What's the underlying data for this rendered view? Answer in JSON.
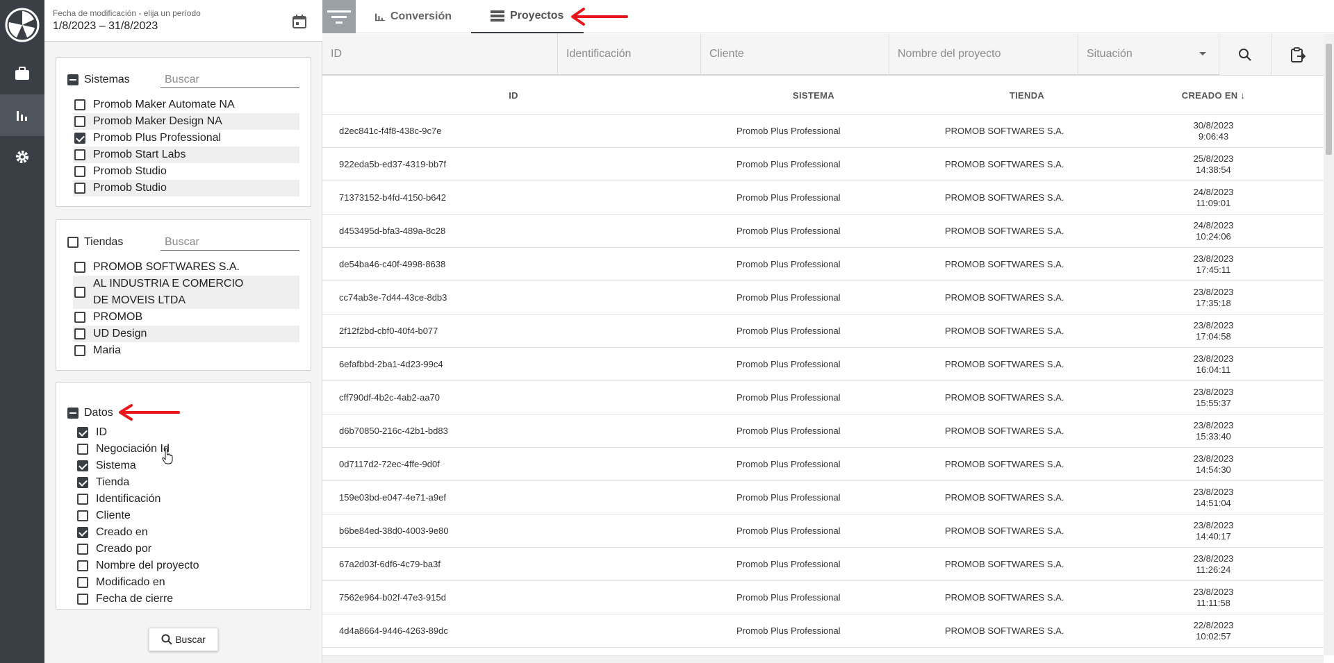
{
  "date_filter": {
    "label": "Fecha de modificación - elija un período",
    "value": "1/8/2023 – 31/8/2023"
  },
  "sistemas": {
    "label": "Sistemas",
    "placeholder": "Buscar",
    "items": [
      {
        "label": "Promob Maker Automate NA",
        "checked": false
      },
      {
        "label": "Promob Maker Design NA",
        "checked": false
      },
      {
        "label": "Promob Plus Professional",
        "checked": true
      },
      {
        "label": "Promob Start Labs",
        "checked": false
      },
      {
        "label": "Promob Studio",
        "checked": false
      },
      {
        "label": "Promob Studio",
        "checked": false
      }
    ]
  },
  "tiendas": {
    "label": "Tiendas",
    "placeholder": "Buscar",
    "items": [
      {
        "label": "PROMOB SOFTWARES S.A.",
        "checked": false
      },
      {
        "label": "AL  INDUSTRIA E COMERCIO DE MOVEIS LTDA",
        "label_line1": "AL  INDUSTRIA E COMERCIO",
        "label_line2": "DE MOVEIS LTDA",
        "checked": false
      },
      {
        "label": "PROMOB",
        "checked": false
      },
      {
        "label": "UD Design",
        "checked": false
      },
      {
        "label": "Maria",
        "checked": false
      }
    ]
  },
  "datos": {
    "label": "Datos",
    "items": [
      {
        "label": "ID",
        "checked": true
      },
      {
        "label": "Negociación Id",
        "checked": false
      },
      {
        "label": "Sistema",
        "checked": true
      },
      {
        "label": "Tienda",
        "checked": true
      },
      {
        "label": "Identificación",
        "checked": false
      },
      {
        "label": "Cliente",
        "checked": false
      },
      {
        "label": "Creado en",
        "checked": true
      },
      {
        "label": "Creado por",
        "checked": false
      },
      {
        "label": "Nombre del proyecto",
        "checked": false
      },
      {
        "label": "Modificado en",
        "checked": false
      },
      {
        "label": "Fecha de cierre",
        "checked": false
      }
    ]
  },
  "search_button": "Buscar",
  "tabs": [
    {
      "label": "Conversión",
      "icon": "bar-chart-icon",
      "active": false
    },
    {
      "label": "Proyectos",
      "icon": "list-icon",
      "active": true
    }
  ],
  "filters": {
    "id_placeholder": "ID",
    "identificacion_placeholder": "Identificación",
    "cliente_placeholder": "Cliente",
    "nombre_placeholder": "Nombre del proyecto",
    "situacion_placeholder": "Situación"
  },
  "table": {
    "headers": {
      "id": "ID",
      "sistema": "SISTEMA",
      "tienda": "TIENDA",
      "creado": "CREADO EN"
    },
    "rows": [
      {
        "id": "d2ec841c-f4f8-438c-9c7e",
        "sistema": "Promob Plus Professional",
        "tienda": "PROMOB SOFTWARES S.A.",
        "fecha": "30/8/2023",
        "hora": "9:06:43"
      },
      {
        "id": "922eda5b-ed37-4319-bb7f",
        "sistema": "Promob Plus Professional",
        "tienda": "PROMOB SOFTWARES S.A.",
        "fecha": "25/8/2023",
        "hora": "14:38:54"
      },
      {
        "id": "71373152-b4fd-4150-b642",
        "sistema": "Promob Plus Professional",
        "tienda": "PROMOB SOFTWARES S.A.",
        "fecha": "24/8/2023",
        "hora": "11:09:01"
      },
      {
        "id": "d453495d-bfa3-489a-8c28",
        "sistema": "Promob Plus Professional",
        "tienda": "PROMOB SOFTWARES S.A.",
        "fecha": "24/8/2023",
        "hora": "10:24:06"
      },
      {
        "id": "de54ba46-c40f-4998-8638",
        "sistema": "Promob Plus Professional",
        "tienda": "PROMOB SOFTWARES S.A.",
        "fecha": "23/8/2023",
        "hora": "17:45:11"
      },
      {
        "id": "cc74ab3e-7d44-43ce-8db3",
        "sistema": "Promob Plus Professional",
        "tienda": "PROMOB SOFTWARES S.A.",
        "fecha": "23/8/2023",
        "hora": "17:35:18"
      },
      {
        "id": "2f12f2bd-cbf0-40f4-b077",
        "sistema": "Promob Plus Professional",
        "tienda": "PROMOB SOFTWARES S.A.",
        "fecha": "23/8/2023",
        "hora": "17:04:58"
      },
      {
        "id": "6efafbbd-2ba1-4d23-99c4",
        "sistema": "Promob Plus Professional",
        "tienda": "PROMOB SOFTWARES S.A.",
        "fecha": "23/8/2023",
        "hora": "16:04:11"
      },
      {
        "id": "cff790df-4b2c-4ab2-aa70",
        "sistema": "Promob Plus Professional",
        "tienda": "PROMOB SOFTWARES S.A.",
        "fecha": "23/8/2023",
        "hora": "15:55:37"
      },
      {
        "id": "d6b70850-216c-42b1-bd83",
        "sistema": "Promob Plus Professional",
        "tienda": "PROMOB SOFTWARES S.A.",
        "fecha": "23/8/2023",
        "hora": "15:33:40"
      },
      {
        "id": "0d7117d2-72ec-4ffe-9d0f",
        "sistema": "Promob Plus Professional",
        "tienda": "PROMOB SOFTWARES S.A.",
        "fecha": "23/8/2023",
        "hora": "14:54:30"
      },
      {
        "id": "159e03bd-e047-4e71-a9ef",
        "sistema": "Promob Plus Professional",
        "tienda": "PROMOB SOFTWARES S.A.",
        "fecha": "23/8/2023",
        "hora": "14:51:04"
      },
      {
        "id": "b6be84ed-38d0-4003-9e80",
        "sistema": "Promob Plus Professional",
        "tienda": "PROMOB SOFTWARES S.A.",
        "fecha": "23/8/2023",
        "hora": "14:40:17"
      },
      {
        "id": "67a2d03f-6df6-4c79-ba3f",
        "sistema": "Promob Plus Professional",
        "tienda": "PROMOB SOFTWARES S.A.",
        "fecha": "23/8/2023",
        "hora": "11:26:24"
      },
      {
        "id": "7562e964-b02f-47e3-915d",
        "sistema": "Promob Plus Professional",
        "tienda": "PROMOB SOFTWARES S.A.",
        "fecha": "23/8/2023",
        "hora": "11:11:58"
      },
      {
        "id": "4d4a8664-9446-4263-89dc",
        "sistema": "Promob Plus Professional",
        "tienda": "PROMOB SOFTWARES S.A.",
        "fecha": "22/8/2023",
        "hora": "10:02:57"
      }
    ]
  },
  "colors": {
    "rail": "#3a3f45",
    "annotation_arrow": "#e8171c"
  }
}
